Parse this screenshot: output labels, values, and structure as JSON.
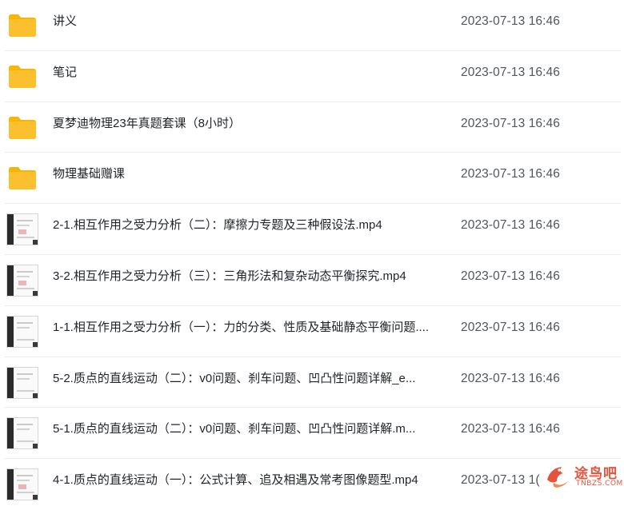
{
  "files": [
    {
      "type": "folder",
      "icon": "folder-icon",
      "name": "讲义",
      "modified": "2023-07-13 16:46"
    },
    {
      "type": "folder",
      "icon": "folder-icon",
      "name": "笔记",
      "modified": "2023-07-13 16:46"
    },
    {
      "type": "folder",
      "icon": "folder-icon",
      "name": "夏梦迪物理23年真题套课（8小时）",
      "modified": "2023-07-13 16:46"
    },
    {
      "type": "folder",
      "icon": "folder-icon",
      "name": "物理基础赠课",
      "modified": "2023-07-13 16:46"
    },
    {
      "type": "video",
      "icon": "video-thumbnail",
      "name": "2-1.相互作用之受力分析（二）：摩擦力专题及三种假设法.mp4",
      "modified": "2023-07-13 16:46"
    },
    {
      "type": "video",
      "icon": "video-thumbnail",
      "name": "3-2.相互作用之受力分析（三）：三角形法和复杂动态平衡探究.mp4",
      "modified": "2023-07-13 16:46"
    },
    {
      "type": "video",
      "icon": "video-thumbnail",
      "name": "1-1.相互作用之受力分析（一）：力的分类、性质及基础静态平衡问题....",
      "modified": "2023-07-13 16:46"
    },
    {
      "type": "video",
      "icon": "video-thumbnail",
      "name": "5-2.质点的直线运动（二）：v0问题、刹车问题、凹凸性问题详解_e...",
      "modified": "2023-07-13 16:46"
    },
    {
      "type": "video",
      "icon": "video-thumbnail",
      "name": "5-1.质点的直线运动（二）：v0问题、刹车问题、凹凸性问题详解.m...",
      "modified": "2023-07-13 16:46"
    },
    {
      "type": "video",
      "icon": "video-thumbnail",
      "name": "4-1.质点的直线运动（一）：公式计算、追及相遇及常考图像题型.mp4",
      "modified": "2023-07-13 1("
    }
  ],
  "watermark": {
    "text": "途鸟吧",
    "sub": "TNBZS.COM"
  },
  "colors": {
    "folder": "#fbc02d",
    "folder_tab": "#f7b500",
    "watermark": "#e5533d",
    "date_text": "#50565e"
  }
}
